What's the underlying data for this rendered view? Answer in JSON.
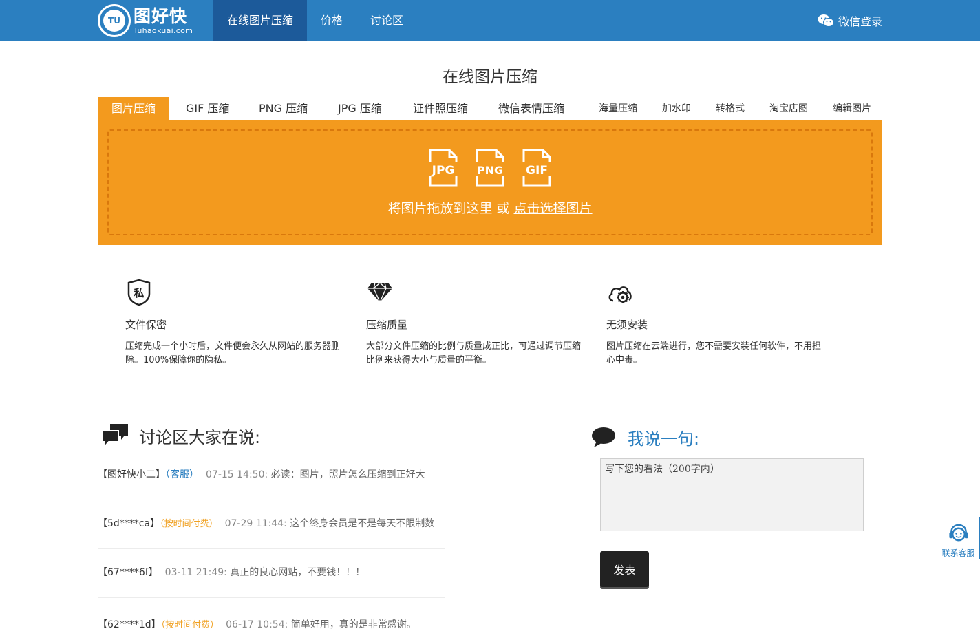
{
  "header": {
    "logo_cn": "图好快",
    "logo_en": "Tuhaokuai.com",
    "logo_badge": "TU",
    "nav": [
      "在线图片压缩",
      "价格",
      "讨论区"
    ],
    "login_label": "微信登录",
    "brand_color": "#2b7fc0"
  },
  "page_title": "在线图片压缩",
  "tabs": [
    "图片压缩",
    "GIF 压缩",
    "PNG 压缩",
    "JPG 压缩",
    "证件照压缩",
    "微信表情压缩",
    "海量压缩",
    "加水印",
    "转格式",
    "淘宝店图",
    "编辑图片"
  ],
  "upload": {
    "file_types": [
      "JPG",
      "PNG",
      "GIF"
    ],
    "drop_text": "将图片拖放到这里 或 ",
    "select_link": "点击选择图片",
    "accent_color": "#f39a1e"
  },
  "features": [
    {
      "icon": "shield-private-icon",
      "title": "文件保密",
      "desc": "压缩完成一个小时后，文件便会永久从网站的服务器删除。100%保障你的隐私。",
      "glyph": "私"
    },
    {
      "icon": "diamond-icon",
      "title": "压缩质量",
      "desc": "大部分文件压缩的比例与质量成正比，可通过调节压缩比例来获得大小与质量的平衡。"
    },
    {
      "icon": "cloud-gear-icon",
      "title": "无须安装",
      "desc": "图片压缩在云端进行，您不需要安装任何软件，不用担心中毒。"
    }
  ],
  "discussion": {
    "title": "讨论区大家在说:",
    "comments": [
      {
        "user": "【图好快小二】",
        "role": "（客服）",
        "time": "07-15 14:50:",
        "msg": "必读：图片，照片怎么压缩到正好大"
      },
      {
        "user": "【5d****ca】",
        "role": "（按时间付费）",
        "time": "07-29 11:44:",
        "msg": "这个终身会员是不是每天不限制数"
      },
      {
        "user": "【67****6f】",
        "role": "",
        "time": "03-11 21:49:",
        "msg": "真正的良心网站，不要钱！！！"
      },
      {
        "user": "【62****1d】",
        "role": "（按时间付费）",
        "time": "06-17 10:54:",
        "msg": "简单好用，真的是非常感谢。"
      }
    ]
  },
  "say": {
    "title": "我说一句:",
    "placeholder": "写下您的看法（200字内）",
    "submit_label": "发表"
  },
  "service": {
    "label": "联系客服"
  }
}
